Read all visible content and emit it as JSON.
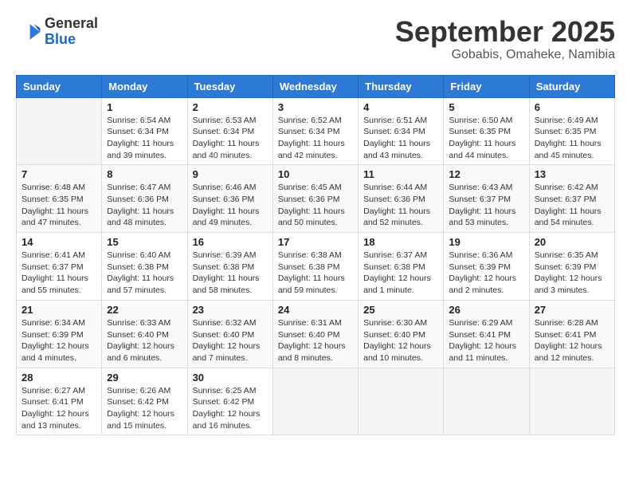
{
  "header": {
    "logo_general": "General",
    "logo_blue": "Blue",
    "month": "September 2025",
    "location": "Gobabis, Omaheke, Namibia"
  },
  "weekdays": [
    "Sunday",
    "Monday",
    "Tuesday",
    "Wednesday",
    "Thursday",
    "Friday",
    "Saturday"
  ],
  "weeks": [
    [
      {
        "day": "",
        "info": ""
      },
      {
        "day": "1",
        "info": "Sunrise: 6:54 AM\nSunset: 6:34 PM\nDaylight: 11 hours\nand 39 minutes."
      },
      {
        "day": "2",
        "info": "Sunrise: 6:53 AM\nSunset: 6:34 PM\nDaylight: 11 hours\nand 40 minutes."
      },
      {
        "day": "3",
        "info": "Sunrise: 6:52 AM\nSunset: 6:34 PM\nDaylight: 11 hours\nand 42 minutes."
      },
      {
        "day": "4",
        "info": "Sunrise: 6:51 AM\nSunset: 6:34 PM\nDaylight: 11 hours\nand 43 minutes."
      },
      {
        "day": "5",
        "info": "Sunrise: 6:50 AM\nSunset: 6:35 PM\nDaylight: 11 hours\nand 44 minutes."
      },
      {
        "day": "6",
        "info": "Sunrise: 6:49 AM\nSunset: 6:35 PM\nDaylight: 11 hours\nand 45 minutes."
      }
    ],
    [
      {
        "day": "7",
        "info": "Sunrise: 6:48 AM\nSunset: 6:35 PM\nDaylight: 11 hours\nand 47 minutes."
      },
      {
        "day": "8",
        "info": "Sunrise: 6:47 AM\nSunset: 6:36 PM\nDaylight: 11 hours\nand 48 minutes."
      },
      {
        "day": "9",
        "info": "Sunrise: 6:46 AM\nSunset: 6:36 PM\nDaylight: 11 hours\nand 49 minutes."
      },
      {
        "day": "10",
        "info": "Sunrise: 6:45 AM\nSunset: 6:36 PM\nDaylight: 11 hours\nand 50 minutes."
      },
      {
        "day": "11",
        "info": "Sunrise: 6:44 AM\nSunset: 6:36 PM\nDaylight: 11 hours\nand 52 minutes."
      },
      {
        "day": "12",
        "info": "Sunrise: 6:43 AM\nSunset: 6:37 PM\nDaylight: 11 hours\nand 53 minutes."
      },
      {
        "day": "13",
        "info": "Sunrise: 6:42 AM\nSunset: 6:37 PM\nDaylight: 11 hours\nand 54 minutes."
      }
    ],
    [
      {
        "day": "14",
        "info": "Sunrise: 6:41 AM\nSunset: 6:37 PM\nDaylight: 11 hours\nand 55 minutes."
      },
      {
        "day": "15",
        "info": "Sunrise: 6:40 AM\nSunset: 6:38 PM\nDaylight: 11 hours\nand 57 minutes."
      },
      {
        "day": "16",
        "info": "Sunrise: 6:39 AM\nSunset: 6:38 PM\nDaylight: 11 hours\nand 58 minutes."
      },
      {
        "day": "17",
        "info": "Sunrise: 6:38 AM\nSunset: 6:38 PM\nDaylight: 11 hours\nand 59 minutes."
      },
      {
        "day": "18",
        "info": "Sunrise: 6:37 AM\nSunset: 6:38 PM\nDaylight: 12 hours\nand 1 minute."
      },
      {
        "day": "19",
        "info": "Sunrise: 6:36 AM\nSunset: 6:39 PM\nDaylight: 12 hours\nand 2 minutes."
      },
      {
        "day": "20",
        "info": "Sunrise: 6:35 AM\nSunset: 6:39 PM\nDaylight: 12 hours\nand 3 minutes."
      }
    ],
    [
      {
        "day": "21",
        "info": "Sunrise: 6:34 AM\nSunset: 6:39 PM\nDaylight: 12 hours\nand 4 minutes."
      },
      {
        "day": "22",
        "info": "Sunrise: 6:33 AM\nSunset: 6:40 PM\nDaylight: 12 hours\nand 6 minutes."
      },
      {
        "day": "23",
        "info": "Sunrise: 6:32 AM\nSunset: 6:40 PM\nDaylight: 12 hours\nand 7 minutes."
      },
      {
        "day": "24",
        "info": "Sunrise: 6:31 AM\nSunset: 6:40 PM\nDaylight: 12 hours\nand 8 minutes."
      },
      {
        "day": "25",
        "info": "Sunrise: 6:30 AM\nSunset: 6:40 PM\nDaylight: 12 hours\nand 10 minutes."
      },
      {
        "day": "26",
        "info": "Sunrise: 6:29 AM\nSunset: 6:41 PM\nDaylight: 12 hours\nand 11 minutes."
      },
      {
        "day": "27",
        "info": "Sunrise: 6:28 AM\nSunset: 6:41 PM\nDaylight: 12 hours\nand 12 minutes."
      }
    ],
    [
      {
        "day": "28",
        "info": "Sunrise: 6:27 AM\nSunset: 6:41 PM\nDaylight: 12 hours\nand 13 minutes."
      },
      {
        "day": "29",
        "info": "Sunrise: 6:26 AM\nSunset: 6:42 PM\nDaylight: 12 hours\nand 15 minutes."
      },
      {
        "day": "30",
        "info": "Sunrise: 6:25 AM\nSunset: 6:42 PM\nDaylight: 12 hours\nand 16 minutes."
      },
      {
        "day": "",
        "info": ""
      },
      {
        "day": "",
        "info": ""
      },
      {
        "day": "",
        "info": ""
      },
      {
        "day": "",
        "info": ""
      }
    ]
  ]
}
